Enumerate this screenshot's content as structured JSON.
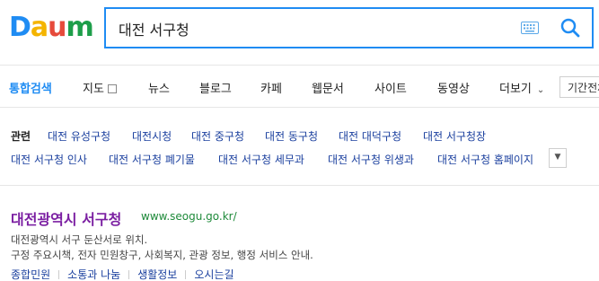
{
  "logo": {
    "letters": [
      "D",
      "a",
      "u",
      "m"
    ],
    "colors": [
      "#1f8cf3",
      "#f4b400",
      "#e64a3b",
      "#1e9e4a"
    ]
  },
  "search": {
    "query": "대전 서구청",
    "keyboard_icon": "keyboard-icon",
    "search_icon": "magnifier-icon"
  },
  "tabs": {
    "items": [
      {
        "label": "통합검색",
        "active": true
      },
      {
        "label": "지도",
        "checkbox": true
      },
      {
        "label": "뉴스"
      },
      {
        "label": "블로그"
      },
      {
        "label": "카페"
      },
      {
        "label": "웹문서"
      },
      {
        "label": "사이트"
      },
      {
        "label": "동영상"
      },
      {
        "label": "더보기",
        "chevron": true
      }
    ],
    "period": "기간전체"
  },
  "related": {
    "label": "관련",
    "row1": [
      "대전 유성구청",
      "대전시청",
      "대전 중구청",
      "대전 동구청",
      "대전 대덕구청",
      "대전 서구청장"
    ],
    "row2": [
      "대전 서구청 인사",
      "대전 서구청 폐기물",
      "대전 서구청 세무과",
      "대전 서구청 위생과",
      "대전 서구청 홈페이지"
    ]
  },
  "result": {
    "title": "대전광역시 서구청",
    "url": "www.seogu.go.kr/",
    "desc1": "대전광역시 서구 둔산서로 위치.",
    "desc2": "구정 주요시책, 전자 민원창구, 사회복지, 관광 정보, 행정 서비스 안내.",
    "sublinks": [
      "종합민원",
      "소통과 나눔",
      "생활정보",
      "오시는길"
    ]
  },
  "accent_color": "#1f8cf3"
}
